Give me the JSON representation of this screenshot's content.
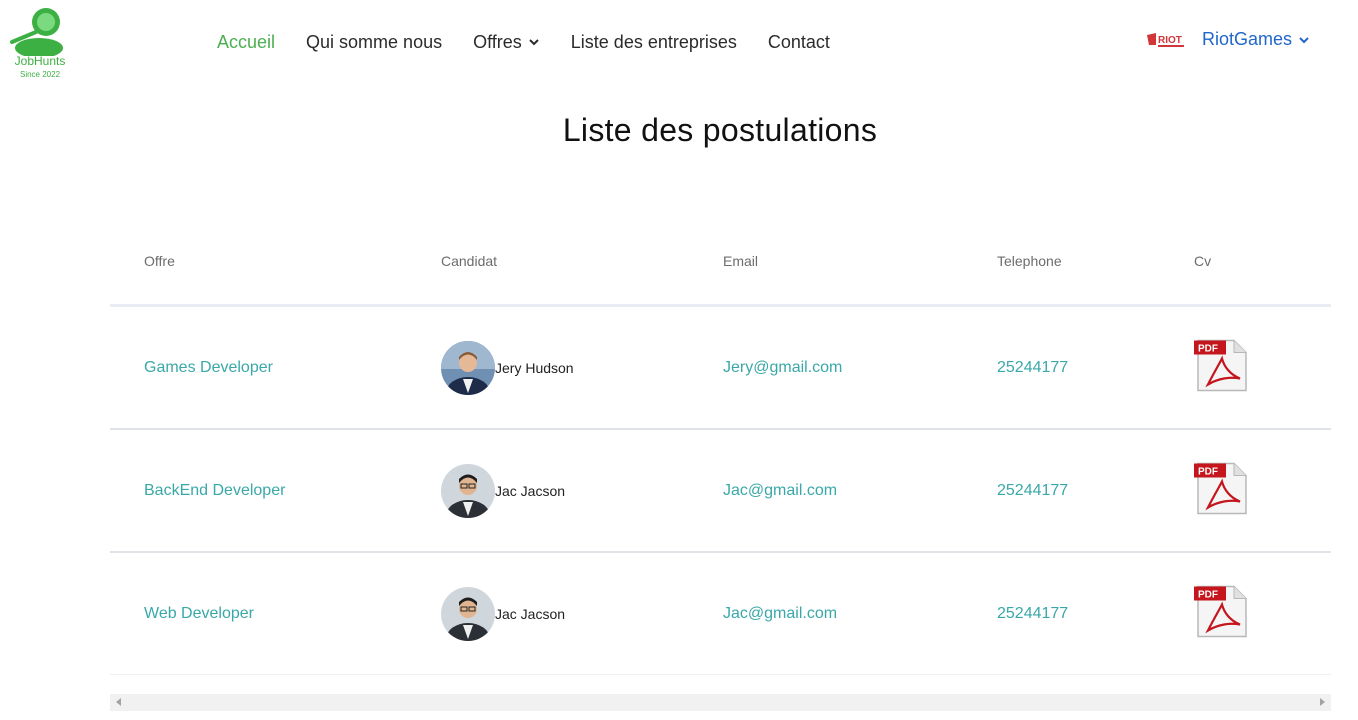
{
  "brand": {
    "name": "JobHunts",
    "since": "Since 2022"
  },
  "nav": {
    "items": [
      {
        "label": "Accueil",
        "active": true,
        "dropdown": false
      },
      {
        "label": "Qui somme nous",
        "active": false,
        "dropdown": false
      },
      {
        "label": "Offres",
        "active": false,
        "dropdown": true
      },
      {
        "label": "Liste des entreprises",
        "active": false,
        "dropdown": false
      },
      {
        "label": "Contact",
        "active": false,
        "dropdown": false
      }
    ],
    "user": {
      "name": "RiotGames",
      "logo_text": "RIOT"
    }
  },
  "page": {
    "title": "Liste des postulations"
  },
  "table": {
    "headers": [
      "Offre",
      "Candidat",
      "Email",
      "Telephone",
      "Cv"
    ],
    "rows": [
      {
        "offre": "Games Developer",
        "candidat": "Jery Hudson",
        "email": "Jery@gmail.com",
        "telephone": "25244177",
        "cv_label": "PDF"
      },
      {
        "offre": "BackEnd Developer",
        "candidat": "Jac Jacson",
        "email": "Jac@gmail.com",
        "telephone": "25244177",
        "cv_label": "PDF"
      },
      {
        "offre": "Web Developer",
        "candidat": "Jac Jacson",
        "email": "Jac@gmail.com",
        "telephone": "25244177",
        "cv_label": "PDF"
      }
    ]
  },
  "colors": {
    "accent_green": "#4caf50",
    "link_teal": "#3aa8a8",
    "user_blue": "#2167c9",
    "pdf_red": "#c4161c"
  }
}
